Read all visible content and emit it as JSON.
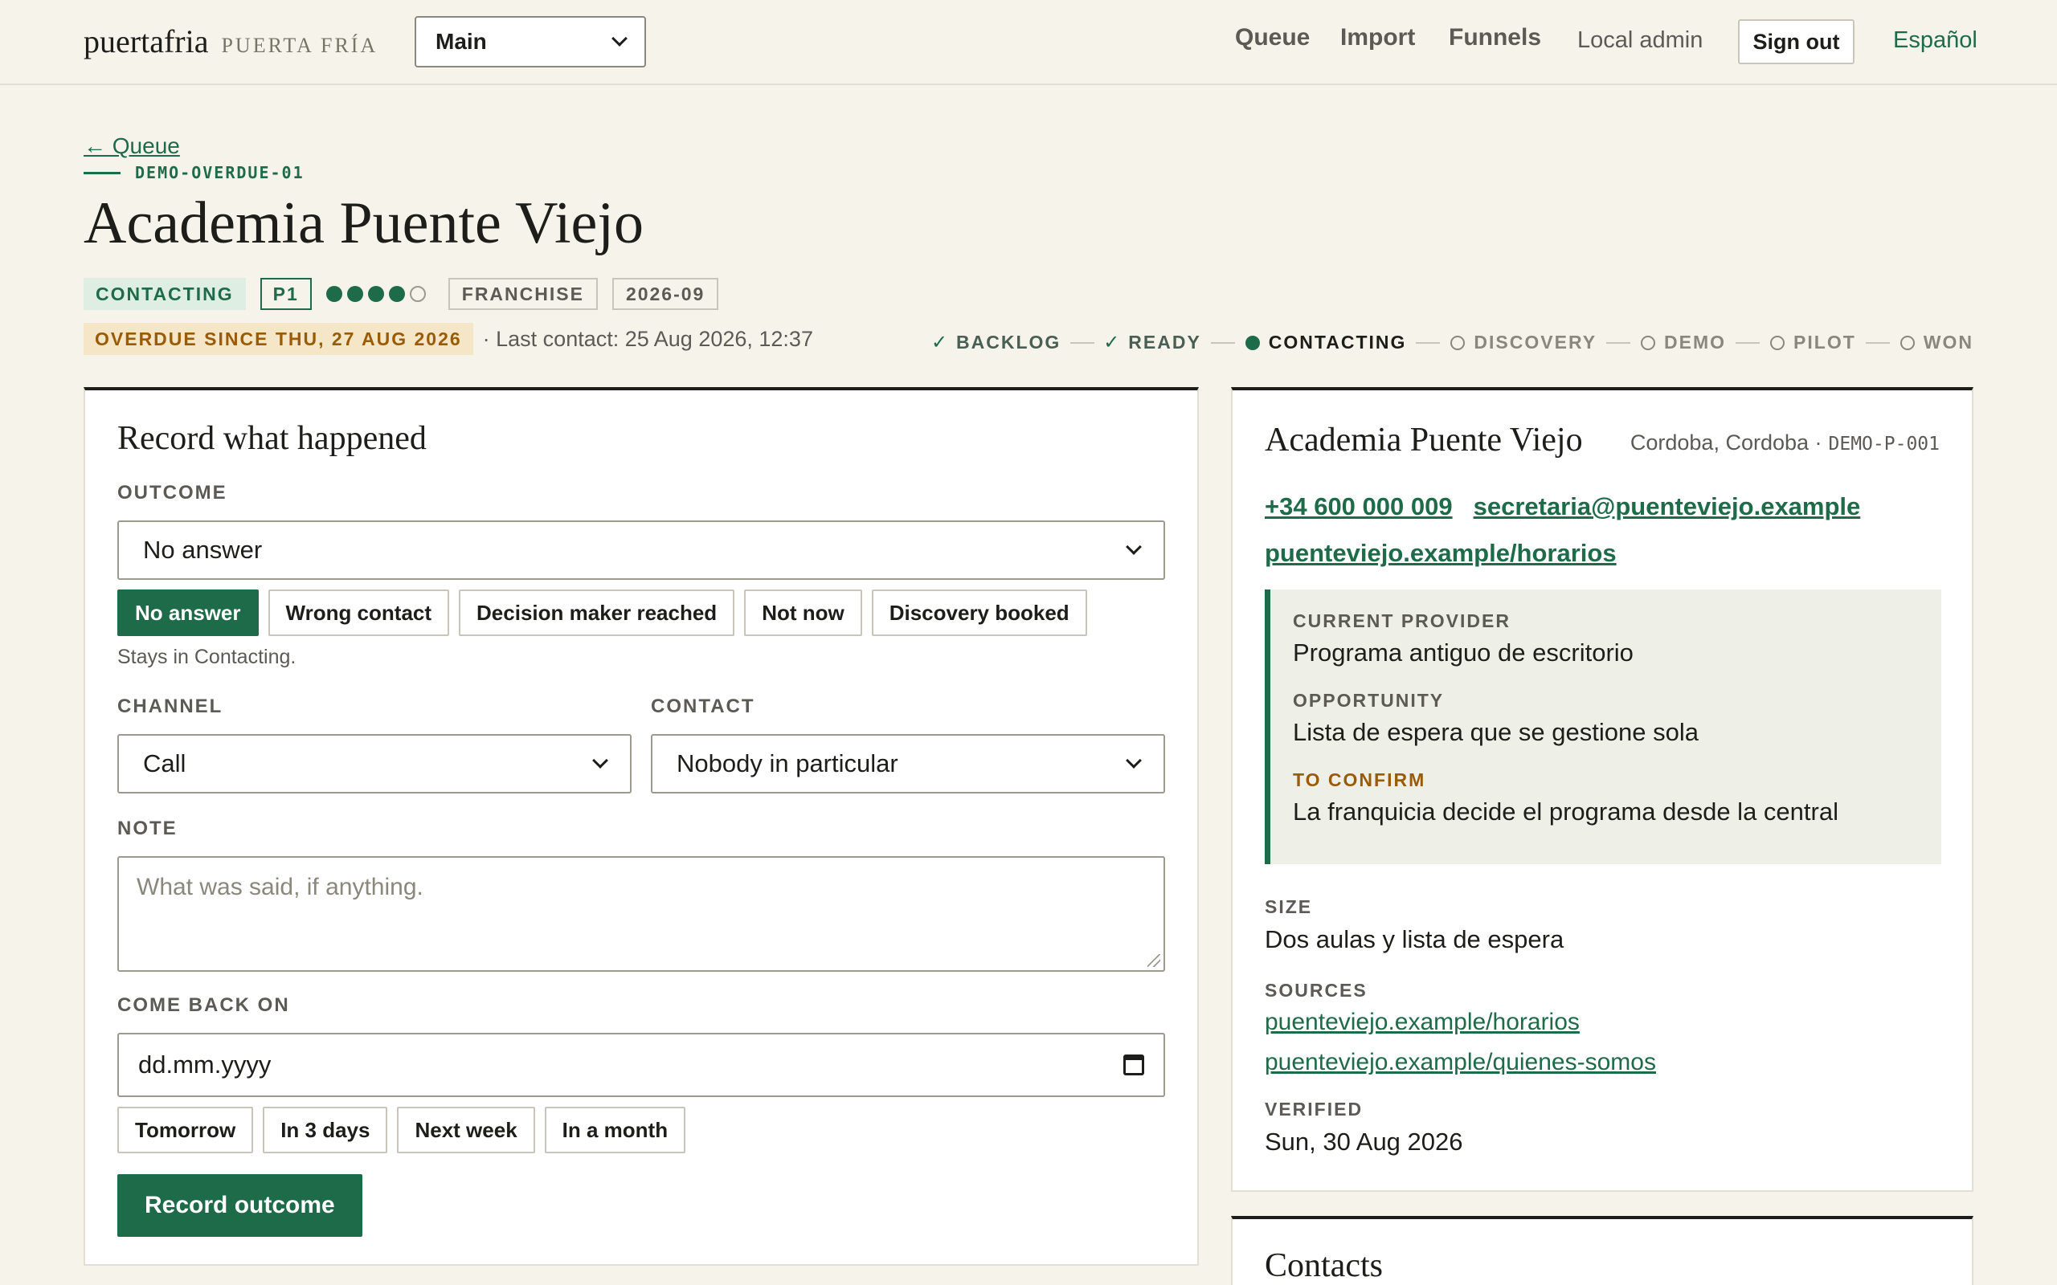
{
  "brand": {
    "name": "puertafria",
    "subtitle": "PUERTA FRÍA"
  },
  "workspace": {
    "selected": "Main"
  },
  "nav": {
    "queue": "Queue",
    "import": "Import",
    "funnels": "Funnels"
  },
  "user": {
    "name": "Local admin",
    "sign_out": "Sign out",
    "language": "Español"
  },
  "header": {
    "back_link": "← Queue",
    "record_code": "DEMO-OVERDUE-01",
    "title": "Academia Puente Viejo",
    "status_badge": "CONTACTING",
    "priority_badge": "P1",
    "rating": {
      "filled": 4,
      "total": 5
    },
    "tags": [
      "FRANCHISE",
      "2026-09"
    ],
    "overdue": "OVERDUE SINCE THU, 27 AUG 2026",
    "last_contact": "· Last contact: 25 Aug 2026, 12:37"
  },
  "pipeline": [
    {
      "label": "BACKLOG",
      "state": "done"
    },
    {
      "label": "READY",
      "state": "done"
    },
    {
      "label": "CONTACTING",
      "state": "current"
    },
    {
      "label": "DISCOVERY",
      "state": "todo"
    },
    {
      "label": "DEMO",
      "state": "todo"
    },
    {
      "label": "PILOT",
      "state": "todo"
    },
    {
      "label": "WON",
      "state": "todo"
    }
  ],
  "record_form": {
    "title": "Record what happened",
    "outcome_label": "OUTCOME",
    "outcome_value": "No answer",
    "outcome_chips": [
      "No answer",
      "Wrong contact",
      "Decision maker reached",
      "Not now",
      "Discovery booked"
    ],
    "outcome_hint": "Stays in Contacting.",
    "channel_label": "CHANNEL",
    "channel_value": "Call",
    "contact_label": "CONTACT",
    "contact_value": "Nobody in particular",
    "note_label": "NOTE",
    "note_placeholder": "What was said, if anything.",
    "come_back_label": "COME BACK ON",
    "date_placeholder": "dd.mm.yyyy",
    "date_chips": [
      "Tomorrow",
      "In 3 days",
      "Next week",
      "In a month"
    ],
    "submit_label": "Record outcome"
  },
  "organization": {
    "name": "Academia Puente Viejo",
    "location": "Cordoba, Cordoba ·",
    "code": "DEMO-P-001",
    "phone": "+34 600 000 009",
    "email": "secretaria@puenteviejo.example",
    "website": "puenteviejo.example/horarios",
    "current_provider_label": "CURRENT PROVIDER",
    "current_provider": "Programa antiguo de escritorio",
    "opportunity_label": "OPPORTUNITY",
    "opportunity": "Lista de espera que se gestione sola",
    "to_confirm_label": "TO CONFIRM",
    "to_confirm": "La franquicia decide el programa desde la central",
    "size_label": "SIZE",
    "size": "Dos aulas y lista de espera",
    "sources_label": "SOURCES",
    "sources": [
      "puenteviejo.example/horarios",
      "puenteviejo.example/quienes-somos"
    ],
    "verified_label": "VERIFIED",
    "verified": "Sun, 30 Aug 2026"
  },
  "contacts": {
    "title": "Contacts"
  },
  "colors": {
    "accent": "#1e6b4a",
    "warning": "#9a5b06",
    "background": "#f6f3ea"
  }
}
